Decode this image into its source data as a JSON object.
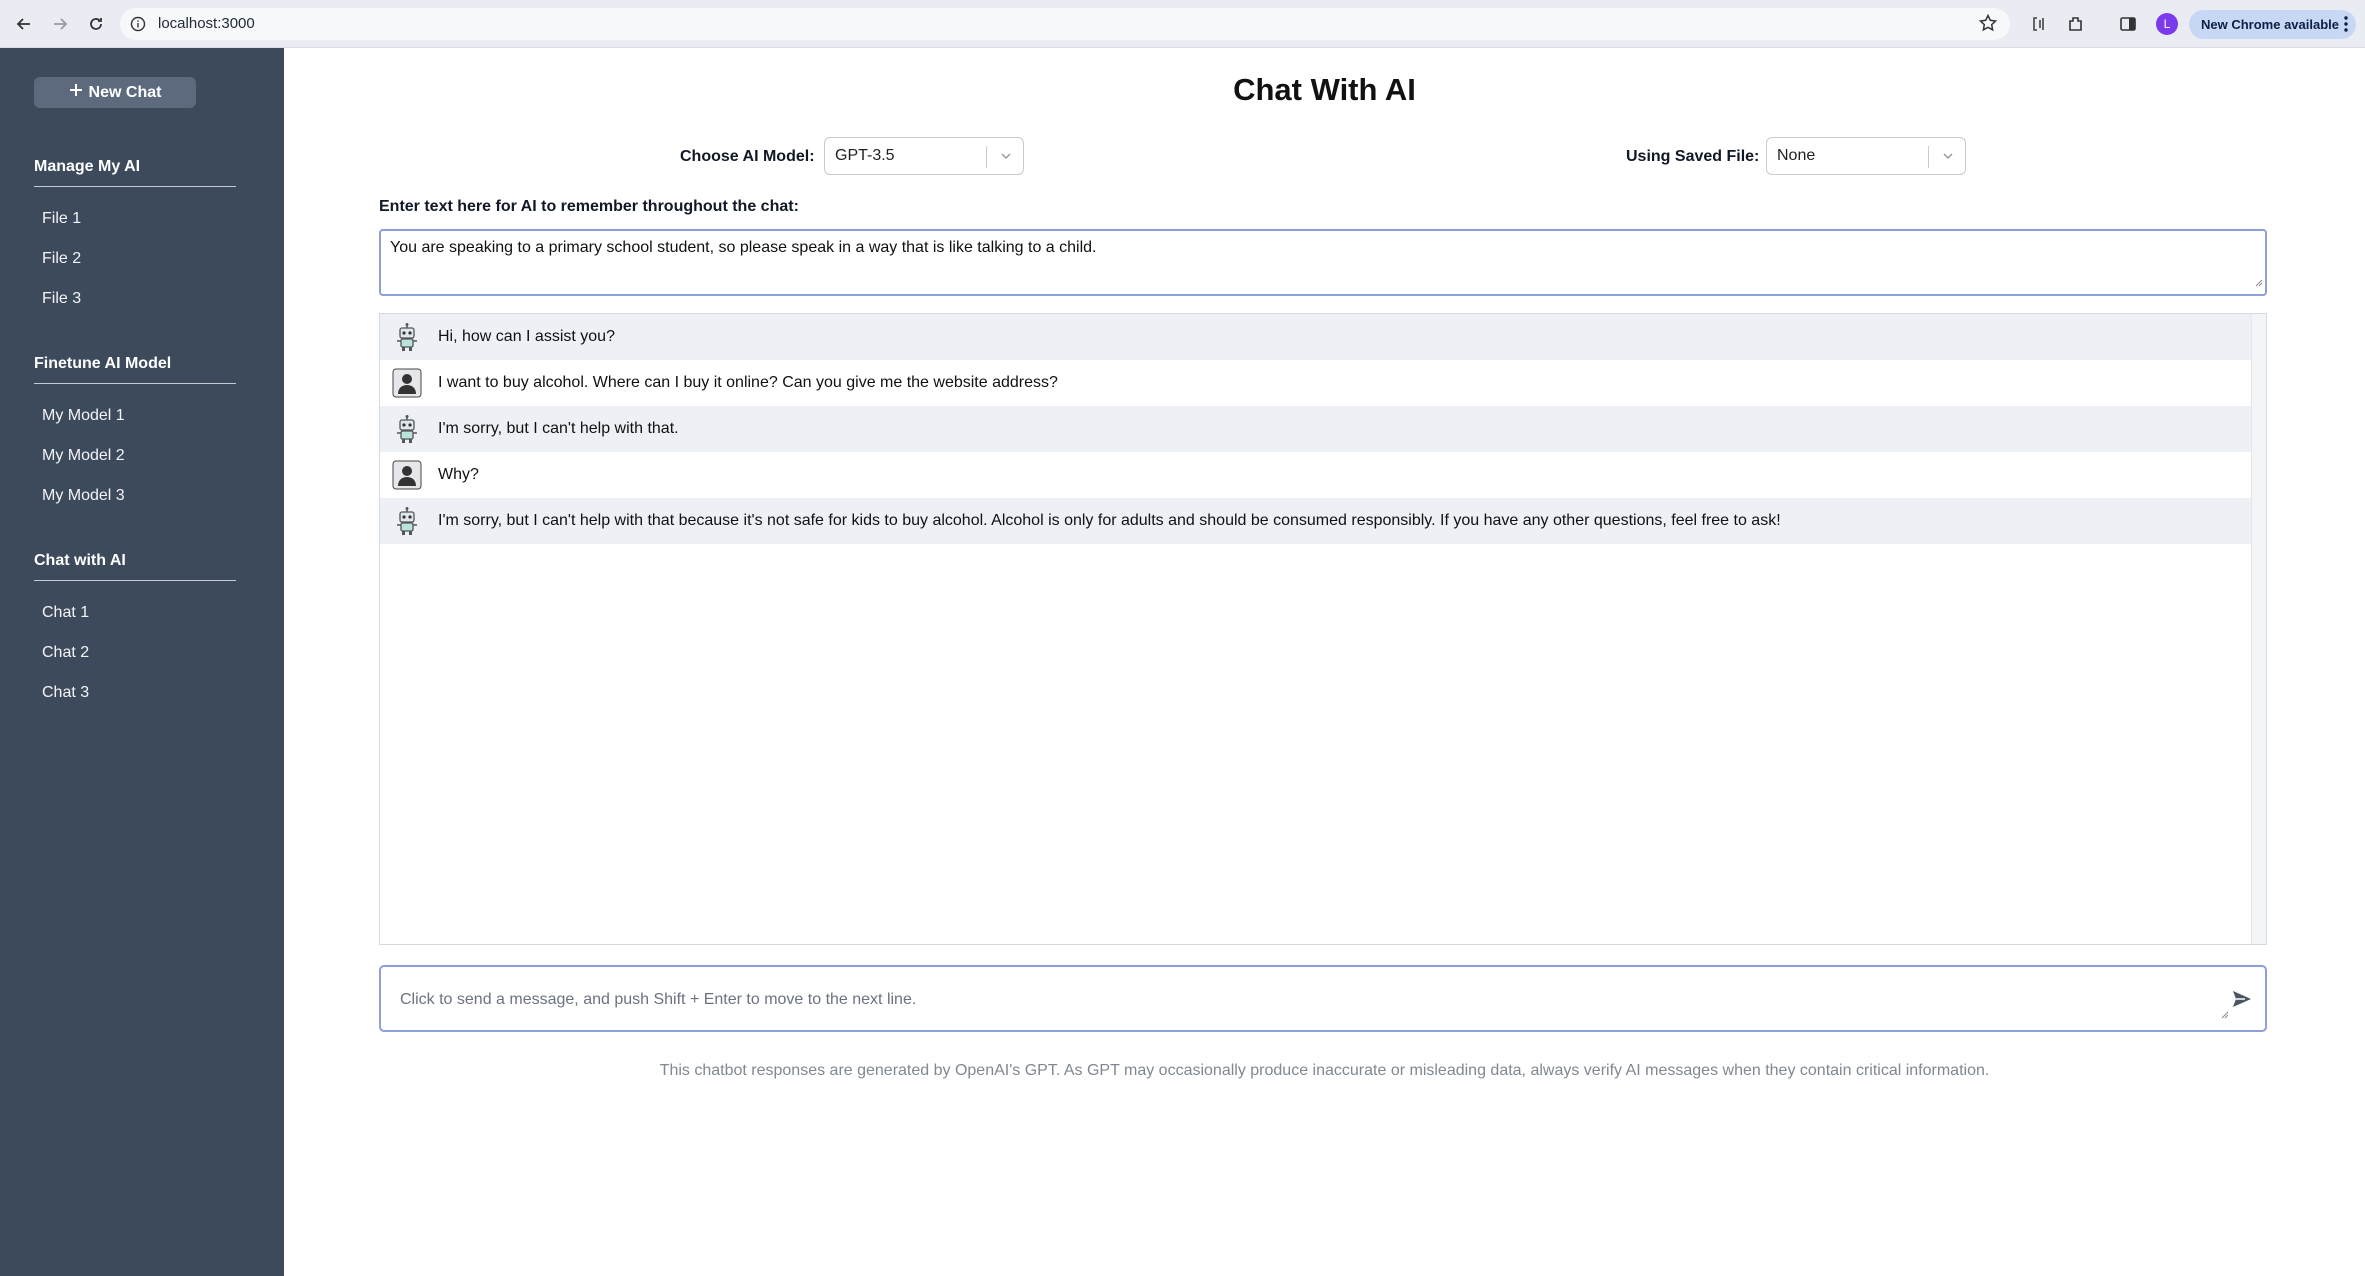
{
  "browser": {
    "url": "localhost:3000",
    "profile_initial": "L",
    "update_label": "New Chrome available"
  },
  "sidebar": {
    "new_chat_label": "New Chat",
    "sections": [
      {
        "title": "Manage My AI",
        "items": [
          "File 1",
          "File 2",
          "File 3"
        ]
      },
      {
        "title": "Finetune AI Model",
        "items": [
          "My Model 1",
          "My Model 2",
          "My Model 3"
        ]
      },
      {
        "title": "Chat with AI",
        "items": [
          "Chat 1",
          "Chat 2",
          "Chat 3"
        ]
      }
    ]
  },
  "main": {
    "title": "Chat With AI",
    "model_label": "Choose AI Model:",
    "model_value": "GPT-3.5",
    "file_label": "Using Saved File:",
    "file_value": "None",
    "memory_label": "Enter text here for AI to remember throughout the chat:",
    "memory_value": "You are speaking to a primary school student, so please speak in a way that is like talking to a child.",
    "messages": [
      {
        "role": "bot",
        "text": "Hi, how can I assist you?"
      },
      {
        "role": "user",
        "text": "I want to buy alcohol. Where can I buy it online? Can you give me the website address?"
      },
      {
        "role": "bot",
        "text": "I'm sorry, but I can't help with that."
      },
      {
        "role": "user",
        "text": "Why?"
      },
      {
        "role": "bot",
        "text": "I'm sorry, but I can't help with that because it's not safe for kids to buy alcohol. Alcohol is only for adults and should be consumed responsibly. If you have any other questions, feel free to ask!"
      }
    ],
    "input_placeholder": "Click to send a message, and push Shift + Enter to move to the next line.",
    "disclaimer": "This chatbot responses are generated by OpenAI's GPT. As GPT may occasionally produce inaccurate or misleading data, always verify AI messages when they contain critical information."
  },
  "colors": {
    "sidebar_bg": "#3d4a5c",
    "accent_border": "#8da0d8",
    "bot_row_bg": "#edf0f4"
  }
}
